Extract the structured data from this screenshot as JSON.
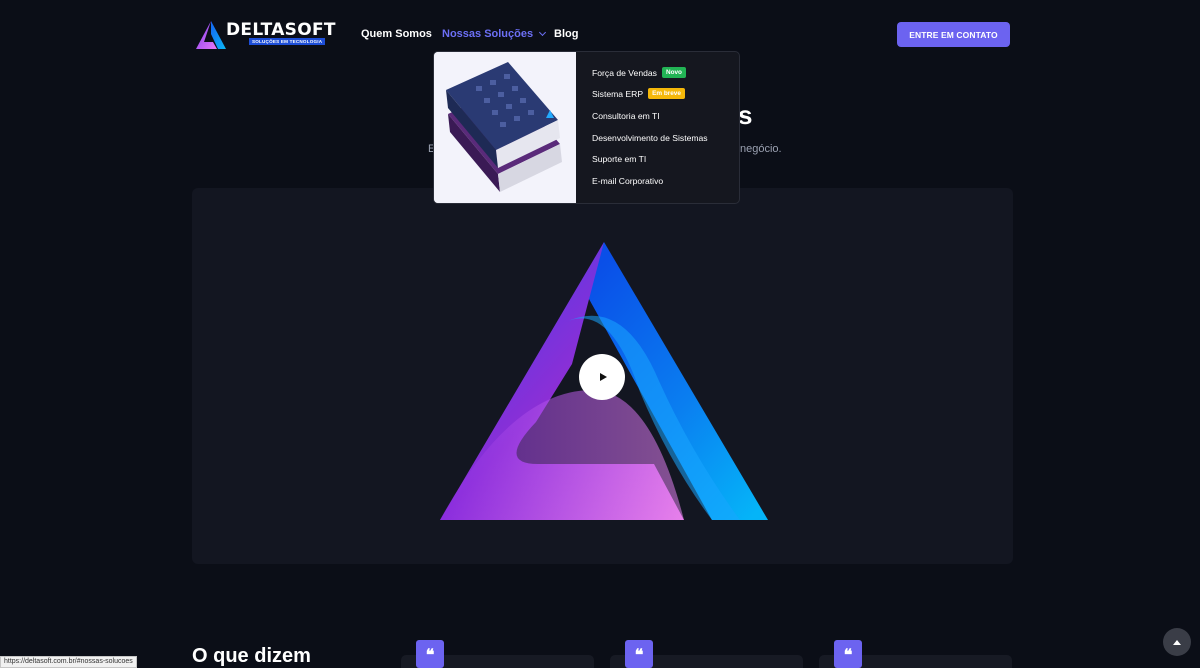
{
  "header": {
    "logo_word": "DELTASOFT",
    "logo_tagline": "SOLUÇÕES EM TECNOLOGIA",
    "nav": [
      {
        "label": "Quem Somos"
      },
      {
        "label": "Nossas Soluções"
      },
      {
        "label": "Blog"
      }
    ],
    "cta_label": "ENTRE EM CONTATO"
  },
  "hero": {
    "title_tail": "s",
    "subtitle_left": "E",
    "subtitle_right": "negócio."
  },
  "dropdown": {
    "items": [
      {
        "label": "Força de Vendas",
        "badge": "Novo"
      },
      {
        "label": "Sistema ERP",
        "badge": "Em breve"
      },
      {
        "label": "Consultoria em TI"
      },
      {
        "label": "Desenvolvimento de Sistemas"
      },
      {
        "label": "Suporte em TI"
      },
      {
        "label": "E-mail Corporativo"
      }
    ]
  },
  "video": {
    "play_icon": "play-icon"
  },
  "testimonials": {
    "title": "O que dizem",
    "quote_mark": "❝"
  },
  "status_bar": {
    "url": "https://deltasoft.com.br/#nossas-solucoes"
  },
  "colors": {
    "accent": "#6c63f0",
    "badge_new": "#22b455",
    "badge_soon": "#f5b80a",
    "background": "#0b0e17"
  }
}
